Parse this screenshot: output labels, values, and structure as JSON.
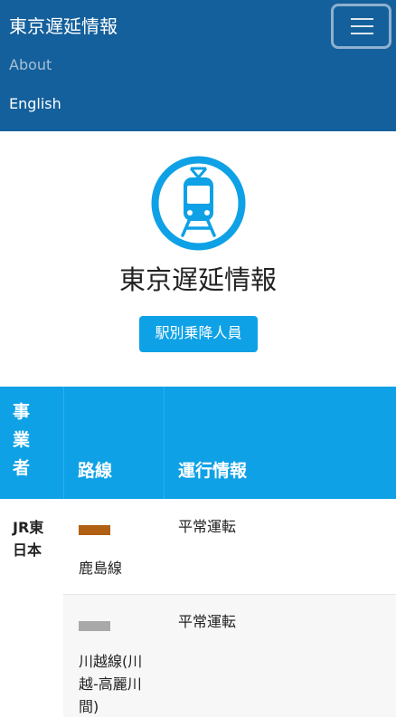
{
  "navbar": {
    "brand": "東京遅延情報",
    "menu_icon": "hamburger-icon",
    "links": [
      "About",
      "English"
    ]
  },
  "hero": {
    "logo_icon": "train-icon",
    "title": "東京遅延情報",
    "button_label": "駅別乗降人員"
  },
  "table": {
    "headers": {
      "company": "事業者",
      "line": "路線",
      "status": "運行情報"
    },
    "rows": [
      {
        "company": "JR東日本",
        "line_color": "#b15f12",
        "line": "鹿島線",
        "status": "平常運転"
      },
      {
        "company": "",
        "line_color": "#a9a9a9",
        "line": "川越線(川越-高麗川間)",
        "status": "平常運転"
      }
    ]
  },
  "colors": {
    "navbar": "#14609c",
    "accent": "#0ea1e6"
  }
}
